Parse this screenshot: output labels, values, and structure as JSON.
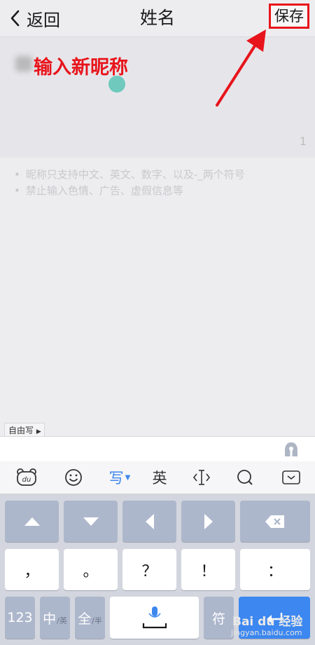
{
  "header": {
    "back_label": "返回",
    "title": "姓名",
    "save_label": "保存"
  },
  "input": {
    "annotation": "输入新昵称",
    "counter": "1"
  },
  "hints": [
    "昵称只支持中文、英文、数字、以及-_两个符号",
    "禁止输入色情、广告、虚假信息等"
  ],
  "keyboard": {
    "freewrite_label": "自由写",
    "toolbar": {
      "write_label": "写",
      "english_label": "英"
    },
    "row2": [
      "，",
      "。",
      "？",
      "！",
      "："
    ],
    "row3": {
      "num_label": "123",
      "zh_label": "中",
      "zh_sub": "/英",
      "full_label": "全",
      "full_sub": "/半",
      "symbol_label": "符"
    }
  },
  "watermark": {
    "brand": "Bai du 经验",
    "url": "jingyan.baidu.com"
  },
  "colors": {
    "annotation_red": "#e8141b",
    "accent_blue": "#3c87f0",
    "cursor_teal": "#6fc9bd"
  }
}
